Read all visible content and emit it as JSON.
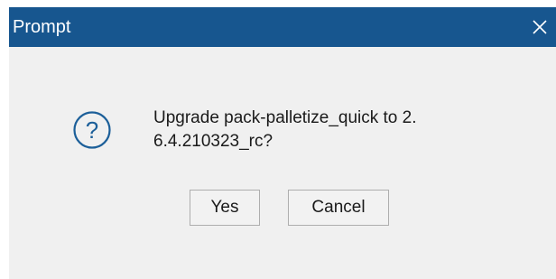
{
  "dialog": {
    "title": "Prompt",
    "close_icon": "close-icon",
    "question_icon": "question-mark-icon",
    "message_line1": "Upgrade pack-palletize_quick to 2.",
    "message_line2": "6.4.210323_rc?",
    "yes_label": "Yes",
    "cancel_label": "Cancel"
  },
  "colors": {
    "titlebar": "#17568f",
    "title_text": "#ffffff",
    "body_bg": "#f0f0f0",
    "icon": "#1c5f99"
  }
}
